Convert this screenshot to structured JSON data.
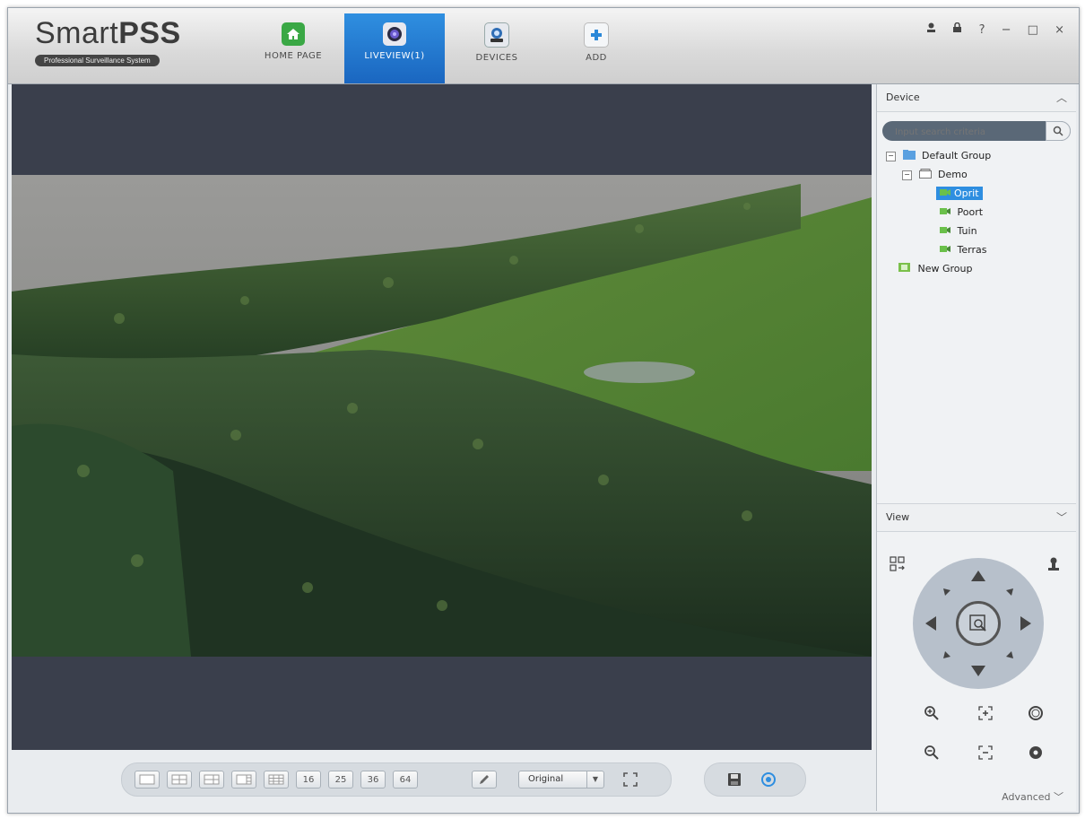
{
  "app": {
    "logo_main": "Smart",
    "logo_bold": "PSS",
    "logo_sub": "Professional Surveillance System"
  },
  "tabs": [
    {
      "label": "HOME PAGE",
      "icon": "home-icon",
      "color": "#3aa845"
    },
    {
      "label": "LIVEVIEW(1)",
      "icon": "camera-lens-icon",
      "color": "#1a66c0"
    },
    {
      "label": "DEVICES",
      "icon": "device-icon",
      "color": "#2f6eb5"
    },
    {
      "label": "ADD",
      "icon": "plus-icon",
      "color": "#2a88d8"
    }
  ],
  "window_controls": {
    "user": "⚲",
    "lock": "🔒",
    "help": "?",
    "minimize": "−",
    "maximize": "□",
    "close": "×"
  },
  "sidebar": {
    "device_title": "Device",
    "search_placeholder": "Input search criteria",
    "tree": {
      "group1": "Default Group",
      "device": "Demo",
      "channels": [
        "Oprit",
        "Poort",
        "Tuin",
        "Terras"
      ],
      "group2": "New Group"
    },
    "view_title": "View",
    "advanced": "Advanced"
  },
  "bottombar": {
    "layouts": [
      "",
      "",
      "",
      "",
      "",
      "16",
      "25",
      "36",
      "64"
    ],
    "aspect_value": "Original"
  },
  "colors": {
    "accent": "#2e8ee0",
    "video_bg": "#3a3f4c",
    "ptz": "#b7c0cb"
  }
}
